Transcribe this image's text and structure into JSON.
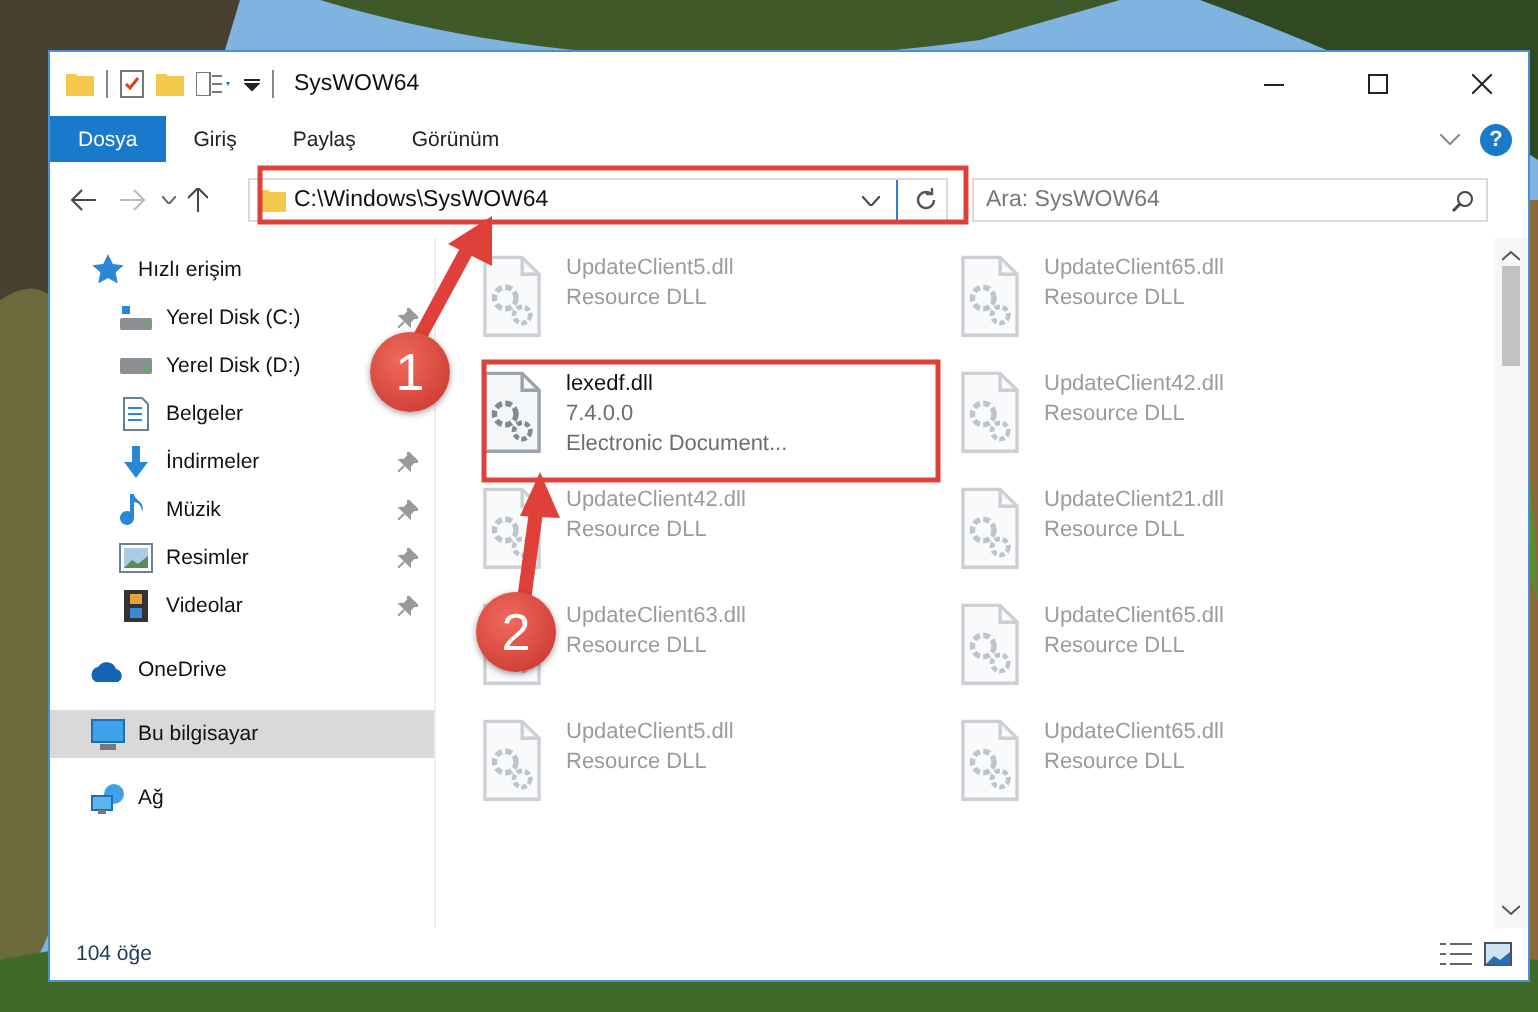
{
  "window": {
    "title": "SysWOW64"
  },
  "ribbon": {
    "tabs": [
      {
        "label": "Dosya",
        "selected": true
      },
      {
        "label": "Giriş",
        "selected": false
      },
      {
        "label": "Paylaş",
        "selected": false
      },
      {
        "label": "Görünüm",
        "selected": false
      }
    ],
    "help": "?"
  },
  "address_bar": {
    "path": "C:\\Windows\\SysWOW64"
  },
  "search": {
    "placeholder": "Ara: SysWOW64"
  },
  "sidebar": {
    "items": [
      {
        "label": "Hızlı erişim",
        "selected": false,
        "children": [
          {
            "label": "Yerel Disk (C:)",
            "pinned": true,
            "selected": false
          },
          {
            "label": "Yerel Disk (D:)",
            "selected": false
          },
          {
            "label": "Belgeler",
            "selected": false
          },
          {
            "label": "İndirmeler",
            "pinned": true,
            "selected": false
          },
          {
            "label": "Müzik",
            "pinned": true,
            "selected": false
          },
          {
            "label": "Resimler",
            "pinned": true,
            "selected": false
          },
          {
            "label": "Videolar",
            "pinned": true,
            "selected": false
          }
        ]
      },
      {
        "label": "OneDrive",
        "selected": false
      },
      {
        "label": "Bu bilgisayar",
        "selected": true
      },
      {
        "label": "Ağ",
        "selected": false
      }
    ]
  },
  "files": [
    {
      "name": "UpdateClient5.dll",
      "details": [
        "Resource DLL"
      ],
      "faded": true
    },
    {
      "name": "UpdateClient65.dll",
      "details": [
        "Resource DLL"
      ],
      "faded": true
    },
    {
      "name": "lexedf.dll",
      "details": [
        "7.4.0.0",
        "Electronic Document..."
      ],
      "faded": false
    },
    {
      "name": "UpdateClient42.dll",
      "details": [
        "Resource DLL"
      ],
      "faded": true
    },
    {
      "name": "UpdateClient42.dll",
      "details": [
        "Resource DLL"
      ],
      "faded": true
    },
    {
      "name": "UpdateClient21.dll",
      "details": [
        "Resource DLL"
      ],
      "faded": true
    },
    {
      "name": "UpdateClient63.dll",
      "details": [
        "Resource DLL"
      ],
      "faded": true
    },
    {
      "name": "UpdateClient65.dll",
      "details": [
        "Resource DLL"
      ],
      "faded": true
    },
    {
      "name": "UpdateClient5.dll",
      "details": [
        "Resource DLL"
      ],
      "faded": true
    },
    {
      "name": "UpdateClient65.dll",
      "details": [
        "Resource DLL"
      ],
      "faded": true
    }
  ],
  "status_bar": {
    "item_count": "104 öğe"
  },
  "annotations": [
    {
      "label": "1"
    },
    {
      "label": "2"
    }
  ]
}
